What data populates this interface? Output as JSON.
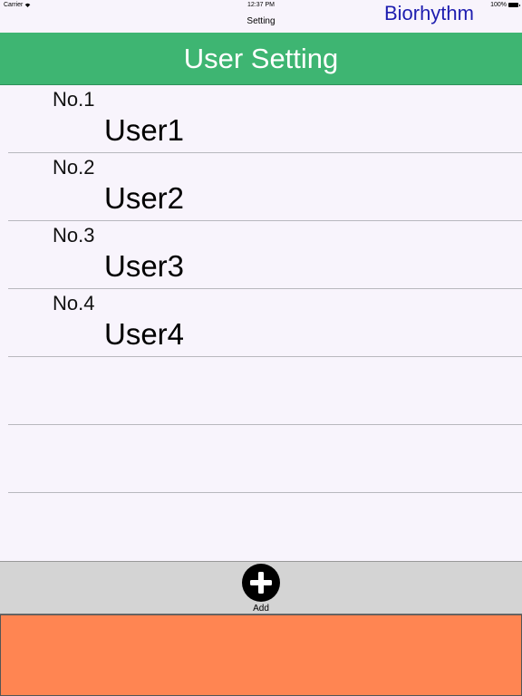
{
  "status_bar": {
    "carrier": "Carrier",
    "time": "12:37 PM",
    "battery": "100%"
  },
  "nav": {
    "title": "Setting",
    "app_name": "Biorhythm"
  },
  "header": {
    "title": "User Setting"
  },
  "users": [
    {
      "number": "No.1",
      "name": "User1"
    },
    {
      "number": "No.2",
      "name": "User2"
    },
    {
      "number": "No.3",
      "name": "User3"
    },
    {
      "number": "No.4",
      "name": "User4"
    },
    {
      "number": "",
      "name": ""
    },
    {
      "number": "",
      "name": ""
    }
  ],
  "toolbar": {
    "add_label": "Add"
  },
  "colors": {
    "header": "#3eb572",
    "app_name": "#1e1eb0",
    "footer": "#ff8552",
    "toolbar": "#d4d4d4"
  }
}
